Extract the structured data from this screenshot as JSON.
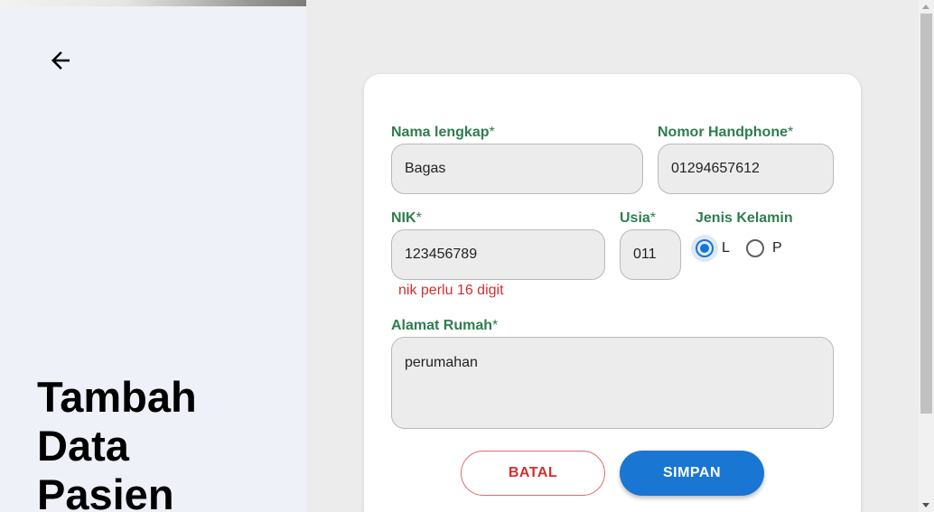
{
  "page": {
    "title": "Tambah Data Pasien"
  },
  "form": {
    "nama": {
      "label": "Nama lengkap",
      "required_mark": "*",
      "value": "Bagas"
    },
    "hp": {
      "label": "Nomor Handphone",
      "required_mark": "*",
      "value": "01294657612"
    },
    "nik": {
      "label": "NIK",
      "required_mark": "*",
      "value": "123456789",
      "error": "nik perlu 16 digit"
    },
    "usia": {
      "label": "Usia",
      "required_mark": "*",
      "value": "011"
    },
    "jenis_kelamin": {
      "label": "Jenis Kelamin",
      "options": [
        {
          "label": "L",
          "selected": true
        },
        {
          "label": "P",
          "selected": false
        }
      ]
    },
    "alamat": {
      "label": "Alamat Rumah",
      "required_mark": "*",
      "value": "perumahan"
    }
  },
  "buttons": {
    "cancel": "BATAL",
    "save": "SIMPAN"
  },
  "icons": {
    "back": "arrow-left-icon"
  },
  "colors": {
    "label": "#2e7d4f",
    "error": "#d32f2f",
    "primary": "#1976d2",
    "left_panel_bg": "#eef1f7",
    "page_bg": "#ececec"
  }
}
